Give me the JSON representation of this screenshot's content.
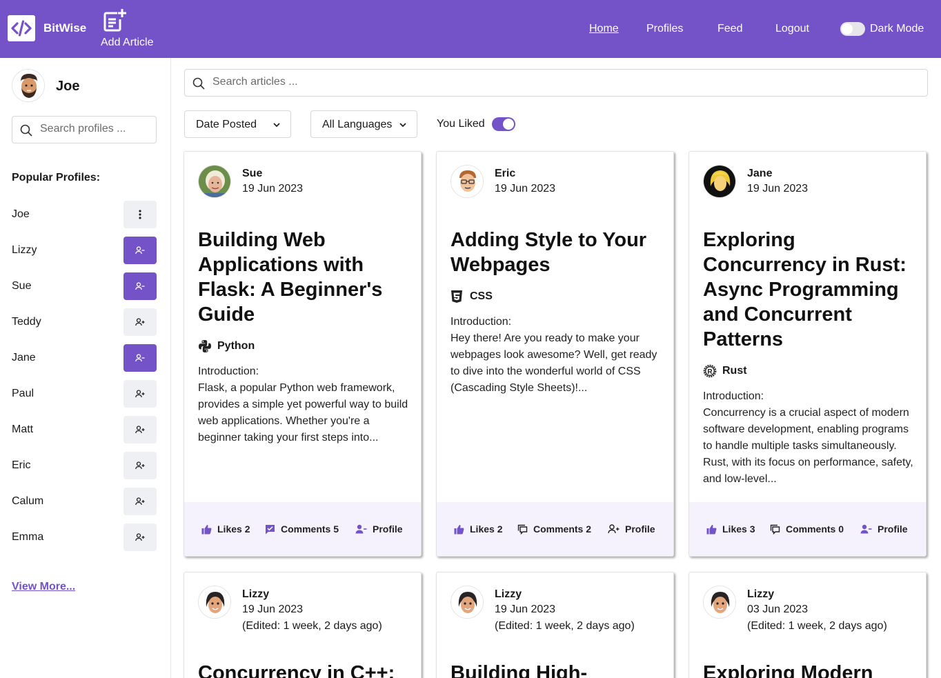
{
  "header": {
    "brand": "BitWise",
    "add_article": "Add Article",
    "nav": {
      "home": "Home",
      "profiles": "Profiles",
      "feed": "Feed",
      "logout": "Logout"
    },
    "dark_mode": "Dark Mode",
    "dark_mode_on": false
  },
  "sidebar": {
    "user_name": "Joe",
    "search_placeholder": "Search profiles ...",
    "popular_title": "Popular Profiles:",
    "profiles": [
      {
        "name": "Joe",
        "action": "more"
      },
      {
        "name": "Lizzy",
        "action": "unfollow"
      },
      {
        "name": "Sue",
        "action": "unfollow"
      },
      {
        "name": "Teddy",
        "action": "follow"
      },
      {
        "name": "Jane",
        "action": "unfollow"
      },
      {
        "name": "Paul",
        "action": "follow"
      },
      {
        "name": "Matt",
        "action": "follow"
      },
      {
        "name": "Eric",
        "action": "follow"
      },
      {
        "name": "Calum",
        "action": "follow"
      },
      {
        "name": "Emma",
        "action": "follow"
      }
    ],
    "view_more": "View More..."
  },
  "main": {
    "search_placeholder": "Search articles ...",
    "sort_select": "Date Posted",
    "language_select": "All Languages",
    "you_liked": "You Liked",
    "you_liked_on": true
  },
  "articles": [
    {
      "author": "Sue",
      "date": "19 Jun 2023",
      "title": "Building Web Applications with Flask: A Beginner's Guide",
      "language": "Python",
      "excerpt_intro": "Introduction:",
      "excerpt": "Flask, a popular Python web framework, provides a simple yet powerful way to build web applications. Whether you're a beginner taking your first steps into...",
      "likes": "Likes 2",
      "comments": "Comments 5",
      "profile": "Profile"
    },
    {
      "author": "Eric",
      "date": "19 Jun 2023",
      "title": "Adding Style to Your Webpages",
      "language": "CSS",
      "excerpt_intro": "Introduction:",
      "excerpt": "Hey there! Are you ready to make your webpages look awesome? Well, get ready to dive into the wonderful world of CSS (Cascading Style Sheets)!...",
      "likes": "Likes 2",
      "comments": "Comments 2",
      "profile": "Profile"
    },
    {
      "author": "Jane",
      "date": "19 Jun 2023",
      "title": "Exploring Concurrency in Rust: Async Programming and Concurrent Patterns",
      "language": "Rust",
      "excerpt_intro": "Introduction:",
      "excerpt": "Concurrency is a crucial aspect of modern software development, enabling programs to handle multiple tasks simultaneously. Rust, with its focus on performance, safety, and low-level...",
      "likes": "Likes 3",
      "comments": "Comments 0",
      "profile": "Profile"
    },
    {
      "author": "Lizzy",
      "date": "19 Jun 2023",
      "edited": "(Edited: 1 week, 2 days ago)",
      "title": "Concurrency in C++:"
    },
    {
      "author": "Lizzy",
      "date": "19 Jun 2023",
      "edited": "(Edited: 1 week, 2 days ago)",
      "title": "Building High-"
    },
    {
      "author": "Lizzy",
      "date": "03 Jun 2023",
      "edited": "(Edited: 1 week, 2 days ago)",
      "title": "Exploring Modern"
    }
  ],
  "colors": {
    "accent": "#7452c8",
    "footer_bg": "#f6f2fd",
    "button_grey": "#eef0f3"
  },
  "icons": [
    "code-logo-icon",
    "add-article-icon",
    "search-icon",
    "more-vertical-icon",
    "user-minus-icon",
    "user-plus-icon",
    "chevron-down-icon",
    "python-icon",
    "css3-icon",
    "rust-icon",
    "thumbs-up-icon",
    "comment-icon"
  ]
}
